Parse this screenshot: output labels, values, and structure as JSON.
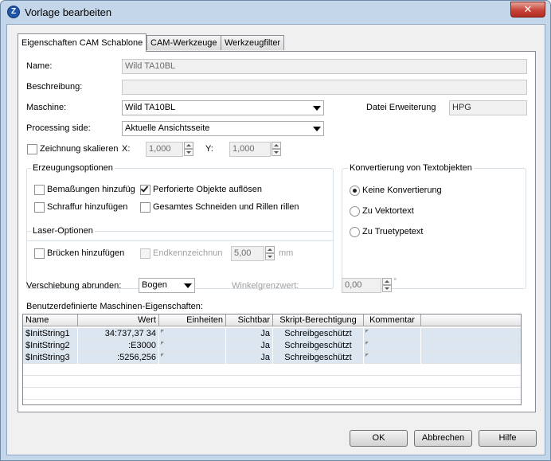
{
  "window": {
    "title": "Vorlage bearbeiten",
    "close_glyph": "✕",
    "app_icon_glyph": "Z"
  },
  "tabs": [
    {
      "label": "Eigenschaften CAM Schablone",
      "active": true
    },
    {
      "label": "CAM-Werkzeuge",
      "active": false
    },
    {
      "label": "Werkzeugfilter",
      "active": false
    }
  ],
  "fields": {
    "name_label": "Name:",
    "name_value": "Wild TA10BL",
    "description_label": "Beschreibung:",
    "description_value": "",
    "machine_label": "Maschine:",
    "machine_value": "Wild TA10BL",
    "file_ext_label": "Datei Erweiterung",
    "file_ext_value": "HPG",
    "processing_label": "Processing side:",
    "processing_value": "Aktuelle Ansichtsseite",
    "scale_label": "Zeichnung skalieren",
    "scale_checked": false,
    "x_label": "X:",
    "x_value": "1,000",
    "y_label": "Y:",
    "y_value": "1,000"
  },
  "generation": {
    "title": "Erzeugungsoptionen",
    "dims_label": "Bemaßungen hinzufüg",
    "dims_checked": false,
    "perforated_label": "Perforierte Objekte auflösen",
    "perforated_checked": true,
    "hatch_label": "Schraffur hinzufügen",
    "hatch_checked": false,
    "cutting_label": "Gesamtes Schneiden und Rillen rillen",
    "cutting_checked": false
  },
  "text_conversion": {
    "title": "Konvertierung von Textobjekten",
    "options": [
      "Keine Konvertierung",
      "Zu Vektortext",
      "Zu Truetypetext"
    ],
    "selected": 0
  },
  "laser": {
    "title": "Laser-Optionen",
    "bridges_label": "Brücken hinzufügen",
    "bridges_checked": false,
    "endmark_label": "Endkennzeichnung",
    "endmark_value": "5,00",
    "unit": "mm"
  },
  "offset": {
    "label": "Verschiebung abrunden:",
    "value": "Bogen",
    "angle_label": "Winkelgrenzwert:",
    "angle_value": "0,00",
    "degree": "°"
  },
  "props": {
    "title": "Benutzerdefinierte Maschinen-Eigenschaften:",
    "columns": [
      "Name",
      "Wert",
      "Einheiten",
      "Sichtbar",
      "Skript-Berechtigung",
      "Kommentar"
    ],
    "rows": [
      [
        "$InitString1",
        "34:737,37 34",
        "",
        "Ja",
        "Schreibgeschützt",
        ""
      ],
      [
        "$InitString2",
        ":E3000",
        "",
        "Ja",
        "Schreibgeschützt",
        ""
      ],
      [
        "$InitString3",
        ":5256,256",
        "",
        "Ja",
        "Schreibgeschützt",
        ""
      ]
    ]
  },
  "buttons": {
    "ok": "OK",
    "cancel": "Abbrechen",
    "help": "Hilfe"
  }
}
